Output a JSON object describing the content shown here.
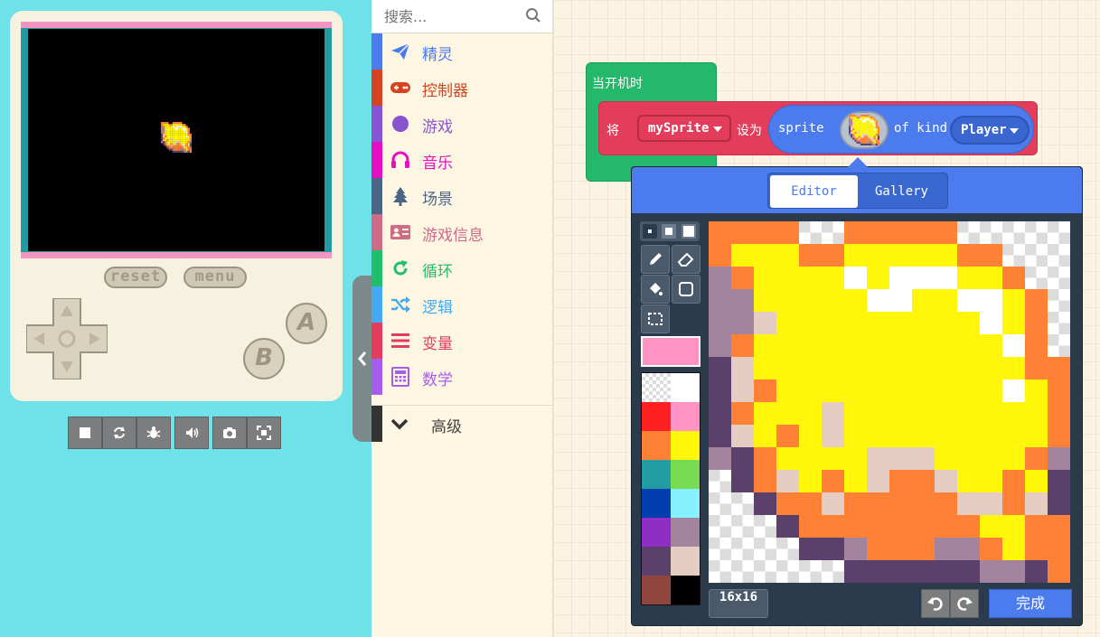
{
  "simulator": {
    "reset_label": "reset",
    "menu_label": "menu",
    "a_label": "A",
    "b_label": "B",
    "toolbar": [
      "stop-icon",
      "restart-icon",
      "debug-icon",
      "sound-icon",
      "screenshot-icon",
      "fullscreen-icon"
    ]
  },
  "toolbox": {
    "search_placeholder": "搜索...",
    "categories": [
      {
        "label": "精灵",
        "color": "#4b7bec",
        "icon": "paper-plane-icon"
      },
      {
        "label": "控制器",
        "color": "#d54322",
        "icon": "gamepad-icon"
      },
      {
        "label": "游戏",
        "color": "#8854d0",
        "icon": "circle-icon"
      },
      {
        "label": "音乐",
        "color": "#e30fc0",
        "icon": "headphones-icon"
      },
      {
        "label": "场景",
        "color": "#4b6584",
        "icon": "tree-icon"
      },
      {
        "label": "游戏信息",
        "color": "#cf6a87",
        "icon": "id-card-icon"
      },
      {
        "label": "循环",
        "color": "#20bf6b",
        "icon": "loop-icon"
      },
      {
        "label": "逻辑",
        "color": "#45aaf2",
        "icon": "shuffle-icon"
      },
      {
        "label": "变量",
        "color": "#e43d5c",
        "icon": "list-icon"
      },
      {
        "label": "数学",
        "color": "#a55eea",
        "icon": "calculator-icon"
      }
    ],
    "advanced_label": "高级"
  },
  "workspace": {
    "hat_label": "当开机时",
    "set_label": "将",
    "variable": "mySprite",
    "to_label": "设为",
    "sprite_label": "sprite",
    "of_kind_label": "of kind",
    "kind_value": "Player"
  },
  "editor": {
    "tab_editor": "Editor",
    "tab_gallery": "Gallery",
    "size_label": "16x16",
    "done_label": "完成",
    "current_color": "#ff93c4",
    "palette": [
      "transparent",
      "#ffffff",
      "#ff2121",
      "#ff93c4",
      "#ff8135",
      "#fff609",
      "#249ca3",
      "#78dc52",
      "#003fad",
      "#87f2ff",
      "#8e2ec4",
      "#a4839f",
      "#5c406c",
      "#e5cdc4",
      "#91463d",
      "#000000"
    ],
    "pixels": [
      "OOOO..OOOOO.....",
      "OYYYOOYYYYYOO...",
      "POYYYYWYWWWYYO..",
      "PPYYYYYWWYYWWYO.",
      "PPSYYYYYYYYYWYO.",
      "POYYYYYYYYYYYWO.",
      "DSYYYYYYYYYYYYOO",
      "DSOYYYYYYYYYYWYO",
      "DOYYYSYYYYYYYYYO",
      "DSYOYSYYYYYYYYYO",
      "MDOYYYYSSSYYYYOP",
      ".DOSYOYSOOSYYOYD",
      "..DOOSOOOOOSSOSD",
      "...DOOOOOOOOYYOO",
      "....DDPOOOPPOYOO",
      "......DDDDDDPPDO"
    ]
  }
}
